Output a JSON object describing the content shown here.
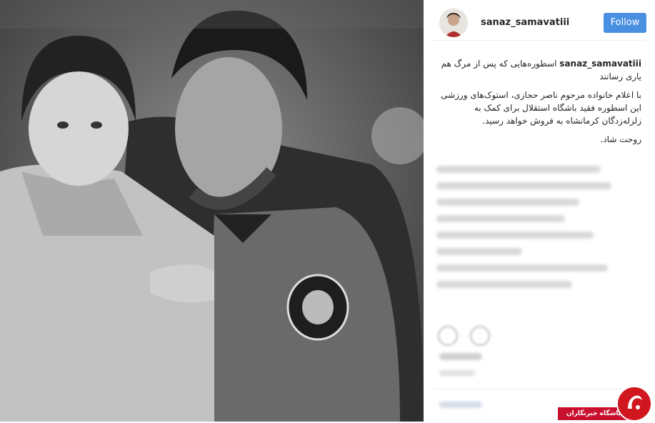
{
  "post": {
    "username": "sanaz_samavatiii",
    "follow_label": "Follow",
    "caption_user": "sanaz_samavatiii",
    "caption_title": "اسطوره‌هایی که پس از مرگ هم یاری رسانند",
    "caption_body": "با اعلام خانواده مرحوم ناصر حجازی، استوک‌های ورزشی این اسطوره فقید باشگاه استقلال برای کمک به زلزله‌زدگان کرمانشاه به فروش خواهد رسید.",
    "caption_end": "روحت شاد."
  },
  "watermark": {
    "text": "باشگاه خبرنگاران"
  },
  "icons": {
    "like": "heart-icon",
    "comment": "comment-icon"
  },
  "colors": {
    "follow_button": "#4a90e2",
    "watermark_red": "#c8102e"
  }
}
